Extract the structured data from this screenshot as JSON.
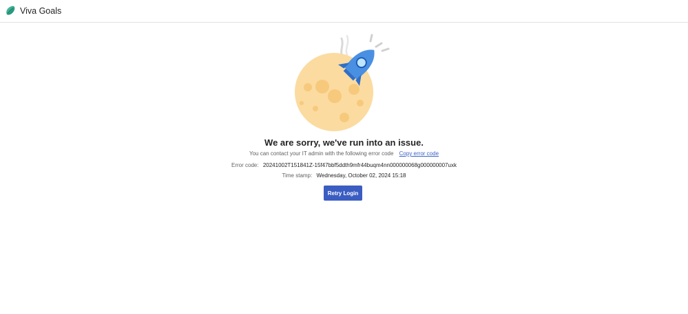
{
  "app": {
    "name": "Viva Goals",
    "logo_icon": "viva-goals-leaf-icon"
  },
  "error": {
    "heading": "We are sorry, we've run into an issue.",
    "contact_text": "You can contact your IT admin with the following error code",
    "copy_link_label": "Copy error code",
    "error_code_label": "Error code:",
    "error_code_value": "20241002T151841Z-15f47bbf5ddth9mfr44buqm4nn000000068g000000007uxk",
    "timestamp_label": "Time stamp:",
    "timestamp_value": "Wednesday, October 02, 2024 15:18",
    "retry_label": "Retry Login",
    "illustration_icon": "moon-rocket-illustration"
  },
  "colors": {
    "primary_button": "#3b5dc2",
    "link": "#3a62c7",
    "moon": "#fbdba0",
    "rocket": "#4a90e2"
  }
}
